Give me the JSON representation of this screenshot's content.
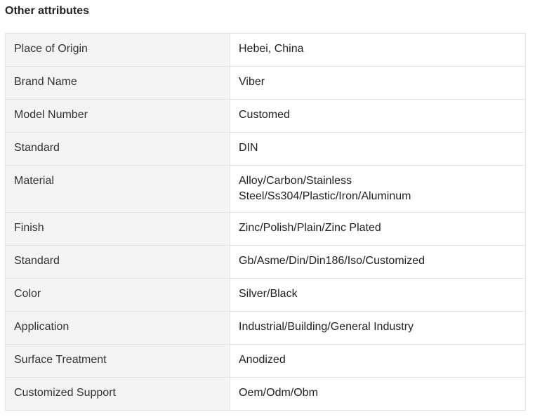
{
  "section": {
    "title": "Other attributes"
  },
  "attributes": [
    {
      "key": "Place of Origin",
      "value": "Hebei, China"
    },
    {
      "key": "Brand Name",
      "value": "Viber"
    },
    {
      "key": "Model Number",
      "value": "Customed"
    },
    {
      "key": "Standard",
      "value": "DIN"
    },
    {
      "key": "Material",
      "value": "Alloy/Carbon/Stainless Steel/Ss304/Plastic/Iron/Aluminum"
    },
    {
      "key": "Finish",
      "value": "Zinc/Polish/Plain/Zinc Plated"
    },
    {
      "key": "Standard",
      "value": "Gb/Asme/Din/Din186/Iso/Customized"
    },
    {
      "key": "Color",
      "value": "Silver/Black"
    },
    {
      "key": "Application",
      "value": "Industrial/Building/General Industry"
    },
    {
      "key": "Surface Treatment",
      "value": "Anodized"
    },
    {
      "key": "Customized Support",
      "value": "Oem/Odm/Obm"
    }
  ]
}
